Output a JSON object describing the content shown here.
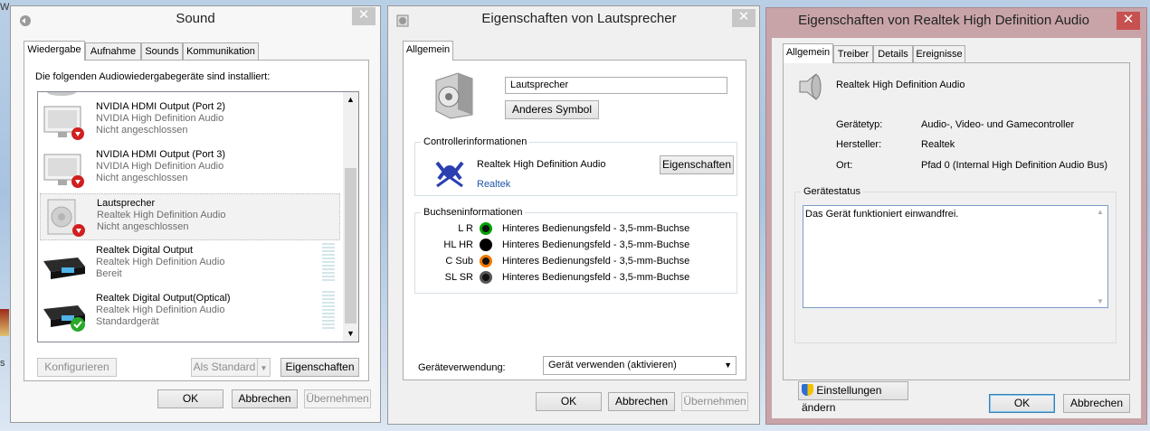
{
  "desktop": {
    "left_fragment": "W",
    "left_bottom_fragment": "s"
  },
  "sound": {
    "title": "Sound",
    "tabs": [
      "Wiedergabe",
      "Aufnahme",
      "Sounds",
      "Kommunikation"
    ],
    "header": "Die folgenden Audiowiedergabegeräte sind installiert:",
    "devices": [
      {
        "name": "NVIDIA HDMI Output (Port 2)",
        "driver": "NVIDIA High Definition Audio",
        "status": "Nicht angeschlossen",
        "icon": "monitor-icon"
      },
      {
        "name": "NVIDIA HDMI Output (Port 3)",
        "driver": "NVIDIA High Definition Audio",
        "status": "Nicht angeschlossen",
        "icon": "monitor-icon"
      },
      {
        "name": "Lautsprecher",
        "driver": "Realtek High Definition Audio",
        "status": "Nicht angeschlossen",
        "icon": "speaker-icon"
      },
      {
        "name": "Realtek Digital Output",
        "driver": "Realtek High Definition Audio",
        "status": "Bereit",
        "icon": "digital-output-icon"
      },
      {
        "name": "Realtek Digital Output(Optical)",
        "driver": "Realtek High Definition Audio",
        "status": "Standardgerät",
        "icon": "digital-output-icon"
      }
    ],
    "buttons": {
      "configure": "Konfigurieren",
      "set_default": "Als Standard",
      "properties": "Eigenschaften",
      "ok": "OK",
      "cancel": "Abbrechen",
      "apply": "Übernehmen"
    }
  },
  "speaker_props": {
    "title": "Eigenschaften von Lautsprecher",
    "tab": "Allgemein",
    "name_value": "Lautsprecher",
    "change_icon": "Anderes Symbol",
    "controller_group": "Controllerinformationen",
    "controller_name": "Realtek High Definition Audio",
    "controller_link": "Realtek",
    "controller_props": "Eigenschaften",
    "jacks_group": "Buchseninformationen",
    "jacks": [
      {
        "label": "L R",
        "desc": "Hinteres Bedienungsfeld - 3,5-mm-Buchse",
        "color": "#00a000"
      },
      {
        "label": "HL HR",
        "desc": "Hinteres Bedienungsfeld - 3,5-mm-Buchse",
        "color": "#000000"
      },
      {
        "label": "C Sub",
        "desc": "Hinteres Bedienungsfeld - 3,5-mm-Buchse",
        "color": "#f07800"
      },
      {
        "label": "SL SR",
        "desc": "Hinteres Bedienungsfeld - 3,5-mm-Buchse",
        "color": "#333333"
      }
    ],
    "usage_label": "Geräteverwendung:",
    "usage_value": "Gerät verwenden (aktivieren)",
    "buttons": {
      "ok": "OK",
      "cancel": "Abbrechen",
      "apply": "Übernehmen"
    }
  },
  "realtek_props": {
    "title": "Eigenschaften von Realtek High Definition Audio",
    "tabs": [
      "Allgemein",
      "Treiber",
      "Details",
      "Ereignisse"
    ],
    "device_name": "Realtek High Definition Audio",
    "rows": [
      {
        "key": "Gerätetyp:",
        "value": "Audio-, Video- und Gamecontroller"
      },
      {
        "key": "Hersteller:",
        "value": "Realtek"
      },
      {
        "key": "Ort:",
        "value": "Pfad 0 (Internal High Definition Audio Bus)"
      }
    ],
    "status_group": "Gerätestatus",
    "status_text": "Das Gerät funktioniert einwandfrei.",
    "change_settings": "Einstellungen ändern",
    "buttons": {
      "ok": "OK",
      "cancel": "Abbrechen"
    }
  },
  "colors": {
    "link": "#1f56a6",
    "close_red": "#c75050",
    "title_pink": "#c8a4a8"
  }
}
